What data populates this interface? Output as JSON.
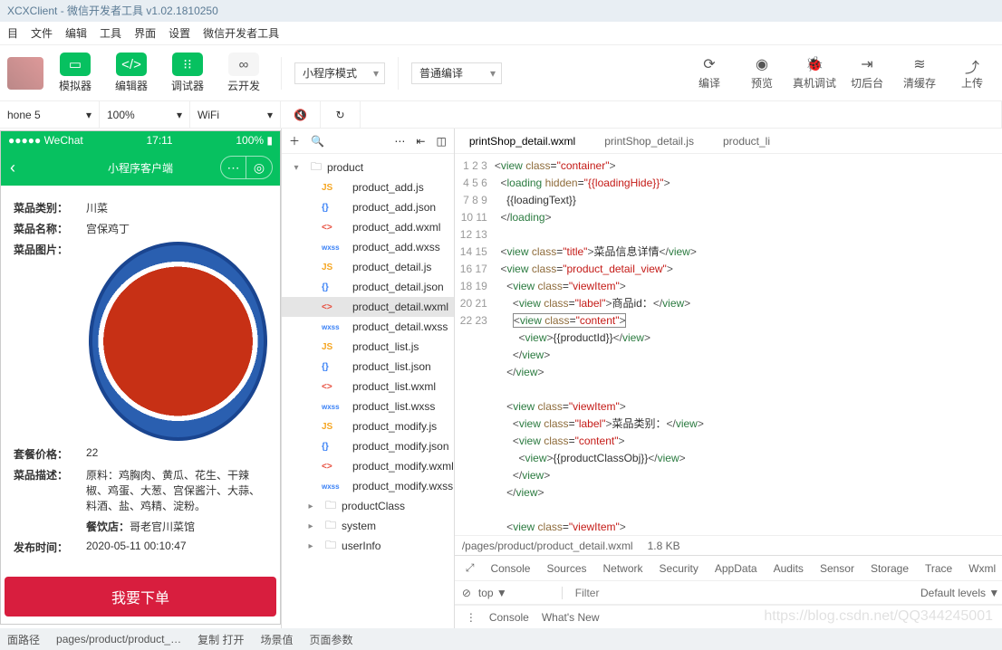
{
  "title": "XCXClient - 微信开发者工具 v1.02.1810250",
  "menu": [
    "目",
    "文件",
    "编辑",
    "工具",
    "界面",
    "设置",
    "微信开发者工具"
  ],
  "toolbar": {
    "sim": "模拟器",
    "editor": "编辑器",
    "debug": "调试器",
    "cloud": "云开发",
    "mode": "小程序模式",
    "compile": "普通编译",
    "compileBtn": "编译",
    "preview": "预览",
    "realdbg": "真机调试",
    "bg": "切后台",
    "clear": "清缓存",
    "upload": "上传"
  },
  "opt": {
    "device": "hone 5",
    "zoom": "100%",
    "net": "WiFi"
  },
  "phone": {
    "carrier": "●●●●● WeChat",
    "time": "17:11",
    "batt": "100%",
    "title": "小程序客户端"
  },
  "dish": {
    "catLab": "菜品类别：",
    "cat": "川菜",
    "nameLab": "菜品名称：",
    "name": "宫保鸡丁",
    "imgLab": "菜品图片：",
    "priceLab": "套餐价格：",
    "price": "22",
    "descLab": "菜品描述：",
    "desc": "原料：鸡胸肉、黄瓜、花生、干辣椒、鸡蛋、大葱、宫保酱汁、大蒜、料酒、盐、鸡精、淀粉。",
    "shopLab": "餐饮店：",
    "shop": "哥老官川菜馆",
    "timeLab": "发布时间：",
    "time": "2020-05-11 00:10:47",
    "order": "我要下单"
  },
  "tree": {
    "root": "product",
    "files": [
      {
        "t": "JS",
        "n": "product_add.js"
      },
      {
        "t": "{}",
        "n": "product_add.json"
      },
      {
        "t": "<>",
        "n": "product_add.wxml"
      },
      {
        "t": "wxss",
        "n": "product_add.wxss"
      },
      {
        "t": "JS",
        "n": "product_detail.js"
      },
      {
        "t": "{}",
        "n": "product_detail.json"
      },
      {
        "t": "<>",
        "n": "product_detail.wxml",
        "sel": true
      },
      {
        "t": "wxss",
        "n": "product_detail.wxss"
      },
      {
        "t": "JS",
        "n": "product_list.js"
      },
      {
        "t": "{}",
        "n": "product_list.json"
      },
      {
        "t": "<>",
        "n": "product_list.wxml"
      },
      {
        "t": "wxss",
        "n": "product_list.wxss"
      },
      {
        "t": "JS",
        "n": "product_modify.js"
      },
      {
        "t": "{}",
        "n": "product_modify.json"
      },
      {
        "t": "<>",
        "n": "product_modify.wxml"
      },
      {
        "t": "wxss",
        "n": "product_modify.wxss"
      }
    ],
    "folders": [
      "productClass",
      "system",
      "userInfo"
    ]
  },
  "editorTabs": [
    "printShop_detail.wxml",
    "printShop_detail.js",
    "product_li"
  ],
  "path": "/pages/product/product_detail.wxml",
  "size": "1.8 KB",
  "console": {
    "tabs": [
      "Console",
      "Sources",
      "Network",
      "Security",
      "AppData",
      "Audits",
      "Sensor",
      "Storage",
      "Trace",
      "Wxml"
    ],
    "ctx": "top",
    "filterPh": "Filter",
    "levels": "Default levels ▼",
    "bot": [
      "Console",
      "What's New"
    ]
  },
  "status": {
    "pathLab": "面路径",
    "path": "pages/product/product_…",
    "copy": "复制 打开",
    "scene": "场景值",
    "params": "页面参数"
  },
  "watermark": "https://blog.csdn.net/QQ344245001"
}
